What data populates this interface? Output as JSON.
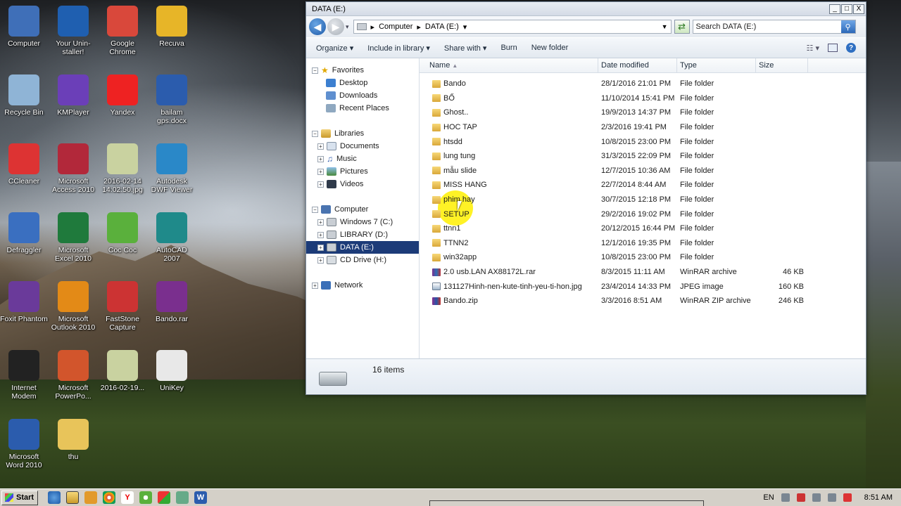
{
  "desktop": {
    "icons": [
      {
        "label": "Computer",
        "icon": "computer-icon"
      },
      {
        "label": "Your Unin-staller!",
        "icon": "uninstaller-icon"
      },
      {
        "label": "Google Chrome",
        "icon": "chrome-icon"
      },
      {
        "label": "Recuva",
        "icon": "recuva-icon"
      },
      {
        "label": "Recycle Bin",
        "icon": "recycle-bin-icon"
      },
      {
        "label": "KMPlayer",
        "icon": "kmplayer-icon"
      },
      {
        "label": "Yandex",
        "icon": "yandex-icon"
      },
      {
        "label": "bailam gps.docx",
        "icon": "word-document-icon"
      },
      {
        "label": "CCleaner",
        "icon": "ccleaner-icon"
      },
      {
        "label": "Microsoft Access 2010",
        "icon": "access-icon"
      },
      {
        "label": "2016-02-14 14:02:50.jpg",
        "icon": "image-file-icon"
      },
      {
        "label": "Autodesk DWF Viewer",
        "icon": "dwf-viewer-icon"
      },
      {
        "label": "Defraggler",
        "icon": "defraggler-icon"
      },
      {
        "label": "Microsoft Excel 2010",
        "icon": "excel-icon"
      },
      {
        "label": "Coc Coc",
        "icon": "coccoc-icon"
      },
      {
        "label": "AutoCAD 2007",
        "icon": "autocad-icon"
      },
      {
        "label": "Foxit Phantom",
        "icon": "foxit-icon"
      },
      {
        "label": "Microsoft Outlook 2010",
        "icon": "outlook-icon"
      },
      {
        "label": "FastStone Capture",
        "icon": "faststone-icon"
      },
      {
        "label": "Bando.rar",
        "icon": "rar-file-icon"
      },
      {
        "label": "Internet Modem",
        "icon": "modem-icon"
      },
      {
        "label": "Microsoft PowerPo...",
        "icon": "powerpoint-icon"
      },
      {
        "label": "2016-02-19...",
        "icon": "image-file-icon"
      },
      {
        "label": "UniKey",
        "icon": "unikey-icon"
      },
      {
        "label": "Microsoft Word 2010",
        "icon": "word-icon"
      },
      {
        "label": "thu",
        "icon": "folder-icon"
      }
    ]
  },
  "window": {
    "title": "DATA (E:)",
    "controls": {
      "minimize": "_",
      "maximize": "□",
      "close": "X"
    },
    "address": {
      "segments": [
        "Computer",
        "DATA (E:)"
      ]
    },
    "search": {
      "placeholder": "Search DATA (E:)"
    },
    "toolbar": {
      "organize": "Organize",
      "include": "Include in library",
      "share": "Share with",
      "burn": "Burn",
      "new_folder": "New folder",
      "help": "?"
    },
    "nav": {
      "favorites": {
        "label": "Favorites",
        "items": [
          "Desktop",
          "Downloads",
          "Recent Places"
        ]
      },
      "libraries": {
        "label": "Libraries",
        "items": [
          "Documents",
          "Music",
          "Pictures",
          "Videos"
        ]
      },
      "computer": {
        "label": "Computer",
        "items": [
          "Windows 7 (C:)",
          "LIBRARY (D:)",
          "DATA (E:)",
          "CD Drive (H:)"
        ]
      },
      "network": {
        "label": "Network"
      }
    },
    "columns": {
      "name": "Name",
      "date": "Date modified",
      "type": "Type",
      "size": "Size"
    },
    "files": [
      {
        "name": "Bando",
        "date": "28/1/2016 21:01 PM",
        "type": "File folder",
        "size": "",
        "kind": "folder"
      },
      {
        "name": "BỐ",
        "date": "11/10/2014 15:41 PM",
        "type": "File folder",
        "size": "",
        "kind": "folder"
      },
      {
        "name": "Ghost..",
        "date": "19/9/2013 14:37 PM",
        "type": "File folder",
        "size": "",
        "kind": "folder"
      },
      {
        "name": "HOC TAP",
        "date": "2/3/2016 19:41 PM",
        "type": "File folder",
        "size": "",
        "kind": "folder"
      },
      {
        "name": "htsdd",
        "date": "10/8/2015 23:00 PM",
        "type": "File folder",
        "size": "",
        "kind": "folder"
      },
      {
        "name": "lung tung",
        "date": "31/3/2015 22:09 PM",
        "type": "File folder",
        "size": "",
        "kind": "folder"
      },
      {
        "name": "mẫu slide",
        "date": "12/7/2015 10:36 AM",
        "type": "File folder",
        "size": "",
        "kind": "folder"
      },
      {
        "name": "MISS HANG",
        "date": "22/7/2014 8:44 AM",
        "type": "File folder",
        "size": "",
        "kind": "folder"
      },
      {
        "name": "phim hay",
        "date": "30/7/2015 12:18 PM",
        "type": "File folder",
        "size": "",
        "kind": "folder"
      },
      {
        "name": "SETUP",
        "date": "29/2/2016 19:02 PM",
        "type": "File folder",
        "size": "",
        "kind": "folder"
      },
      {
        "name": "ttnn1",
        "date": "20/12/2015 16:44 PM",
        "type": "File folder",
        "size": "",
        "kind": "folder"
      },
      {
        "name": "TTNN2",
        "date": "12/1/2016 19:35 PM",
        "type": "File folder",
        "size": "",
        "kind": "folder"
      },
      {
        "name": "win32app",
        "date": "10/8/2015 23:00 PM",
        "type": "File folder",
        "size": "",
        "kind": "folder"
      },
      {
        "name": "2.0 usb.LAN AX88172L.rar",
        "date": "8/3/2015 11:11 AM",
        "type": "WinRAR archive",
        "size": "46 KB",
        "kind": "rar"
      },
      {
        "name": "131127Hinh-nen-kute-tinh-yeu-ti-hon.jpg",
        "date": "23/4/2014 14:33 PM",
        "type": "JPEG image",
        "size": "160 KB",
        "kind": "jpg"
      },
      {
        "name": "Bando.zip",
        "date": "3/3/2016 8:51 AM",
        "type": "WinRAR ZIP archive",
        "size": "246 KB",
        "kind": "zip"
      }
    ],
    "status": {
      "count": "16 items"
    }
  },
  "taskbar": {
    "start": "Start",
    "language": "EN",
    "clock": "8:51 AM"
  },
  "colors": {
    "selection": "#1c3b78",
    "highlight": "#fff000",
    "accent": "#2c68b8"
  }
}
